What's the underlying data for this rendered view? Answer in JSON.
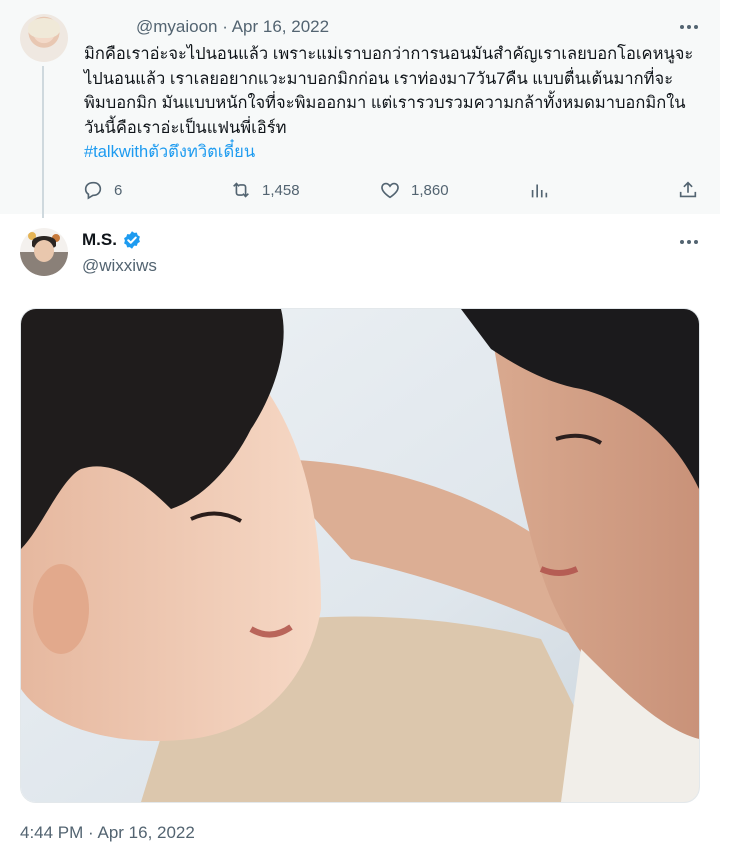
{
  "parent_tweet": {
    "handle": "@myaioon",
    "separator": "·",
    "date": "Apr 16, 2022",
    "more_icon": "more-horizontal-icon",
    "text_lines": [
      "มิกคือเราอ่ะจะไปนอนแล้ว เพราะแม่เราบอกว่าการนอนมันสำคัญเราเลยบอกโอเคหนูจะ",
      "ไปนอนแล้ว เราเลยอยากแวะมาบอกมิกก่อน เราท่องมา7วัน7คืน แบบตื่นเต้นมากที่จะ",
      "พิมบอกมิก มันแบบหนักใจที่จะพิมออกมา แต่เรารวบรวมความกล้าทั้งหมดมาบอกมิกใน",
      "วันนี้คือเราอ่ะเป็นแฟนพี่เอิร์ท"
    ],
    "hashtag": "#talkwithตัวตึงทวิตเดี๋ยน",
    "reply_count": "6",
    "retweet_count": "1,458",
    "like_count": "1,860"
  },
  "main_tweet": {
    "name": "M.S.",
    "handle": "@wixxiws",
    "timestamp": "4:44 PM · Apr 16, 2022"
  },
  "colors": {
    "accent": "#1d9bf0",
    "secondary_text": "#536471",
    "parent_background": "#f7f9f9"
  },
  "icons": [
    "reply-icon",
    "retweet-icon",
    "like-icon",
    "analytics-icon",
    "share-icon",
    "verified-badge-icon",
    "more-horizontal-icon"
  ]
}
